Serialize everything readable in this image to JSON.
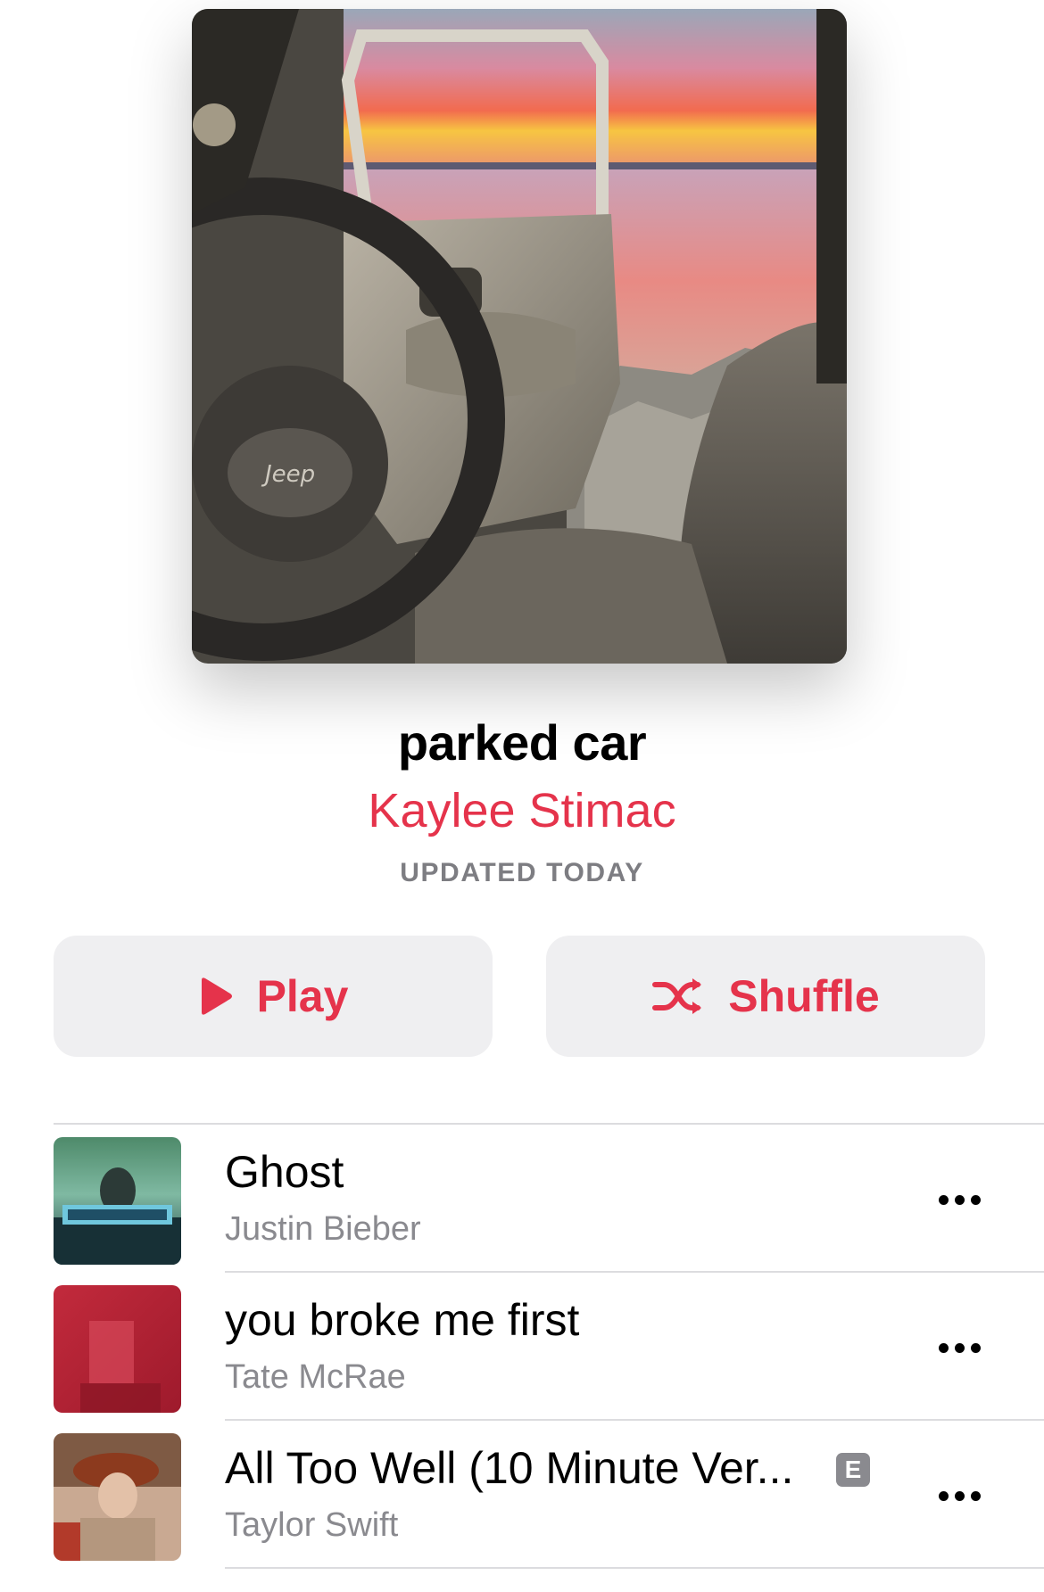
{
  "playlist": {
    "title": "parked car",
    "curator": "Kaylee Stimac",
    "updated": "UPDATED TODAY",
    "artwork_icon": "playlist-artwork"
  },
  "actions": {
    "play_label": "Play",
    "shuffle_label": "Shuffle",
    "accent_color": "#e5334b"
  },
  "tracks": [
    {
      "title": "Ghost",
      "artist": "Justin Bieber",
      "explicit": false,
      "artwork_icon": "album-art-justice"
    },
    {
      "title": "you broke me first",
      "artist": "Tate McRae",
      "explicit": false,
      "artwork_icon": "album-art-you-broke-me-first"
    },
    {
      "title": "All Too Well (10 Minute Ver...",
      "artist": "Taylor Swift",
      "explicit": true,
      "explicit_badge": "E",
      "artwork_icon": "album-art-red-taylors-version"
    }
  ]
}
